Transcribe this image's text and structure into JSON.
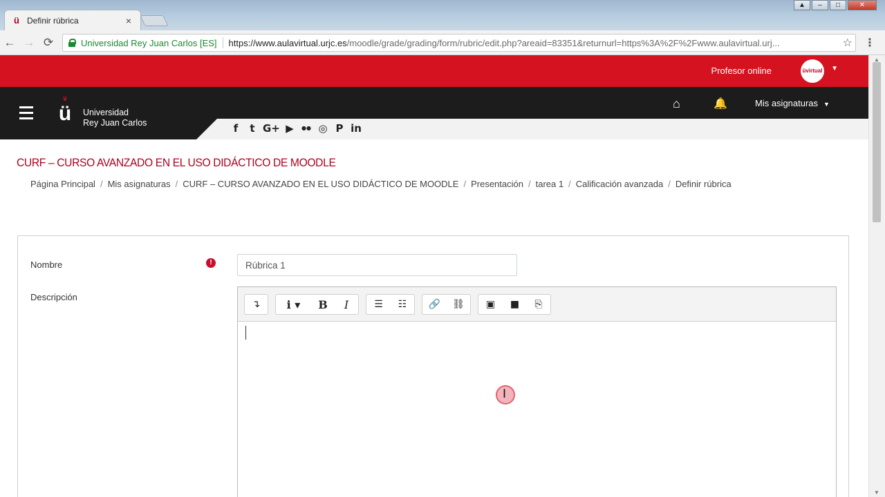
{
  "browser": {
    "tab_title": "Definir rúbrica",
    "tab_close": "×",
    "site_identity": "Universidad Rey Juan Carlos [ES]",
    "url_host": "https://www.aulavirtual.urjc.es",
    "url_path": "/moodle/grade/grading/form/rubric/edit.php?areaid=83351&returnurl=https%3A%2F%2Fwww.aulavirtual.urj...",
    "back_icon": "←",
    "forward_icon": "→",
    "reload_icon": "⟳",
    "star_icon": "☆",
    "menu_icon": "⋮"
  },
  "topbar": {
    "user_name": "Profesor online",
    "avatar_text": "üvirtual",
    "color": "#d5121f"
  },
  "navbar": {
    "logo_line1": "Universidad",
    "logo_line2": "Rey Juan Carlos",
    "logo_mark": "ü",
    "home_icon": "⌂",
    "bell_icon": "🔔",
    "courses_label": "Mis asignaturas",
    "social": [
      "f",
      "t",
      "G+",
      "▶",
      "●●",
      "◎",
      "P",
      "in"
    ]
  },
  "course_title": "CURF – CURSO AVANZADO EN EL USO DIDÁCTICO DE MOODLE",
  "breadcrumb": [
    "Página Principal",
    "Mis asignaturas",
    "CURF – CURSO AVANZADO EN EL USO DIDÁCTICO DE MOODLE",
    "Presentación",
    "tarea 1",
    "Calificación avanzada",
    "Definir rúbrica"
  ],
  "form": {
    "name_label": "Nombre",
    "name_value": "Rúbrica 1",
    "required_icon": "!",
    "description_label": "Descripción"
  },
  "editor_toolbar": {
    "collapse": "↴",
    "info": "i ▾",
    "bold": "B",
    "italic": "I",
    "bullet_list": "☰",
    "numbered_list": "☷",
    "link": "🔗",
    "unlink": "⛓",
    "image": "▣",
    "media": "■",
    "manage_files": "⎘"
  }
}
